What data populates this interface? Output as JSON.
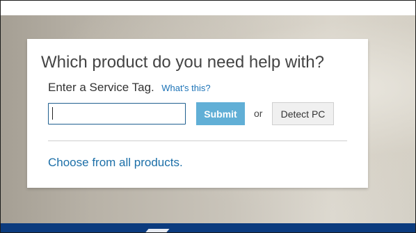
{
  "card": {
    "title": "Which product do you need help with?",
    "service_tag_label": "Enter a Service Tag.",
    "whats_this_link": "What's this?",
    "service_tag_input": {
      "value": "",
      "placeholder": ""
    },
    "submit_label": "Submit",
    "or_text": "or",
    "detect_pc_label": "Detect PC",
    "choose_all_link": "Choose from all products."
  },
  "colors": {
    "accent_button": "#61afd6",
    "link": "#1c73b7",
    "footer_band": "#0b3b7e",
    "input_border": "#1f5f8f"
  }
}
